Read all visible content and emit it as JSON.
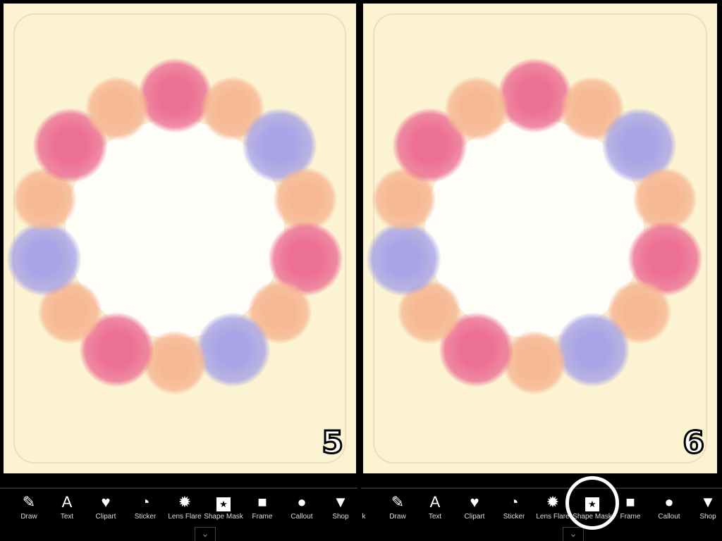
{
  "panels": [
    {
      "step_number": "5",
      "highlighted_tool": null
    },
    {
      "step_number": "6",
      "highlighted_tool": "Shape Mask"
    }
  ],
  "toolbar": {
    "tools": [
      {
        "label": "Draw",
        "icon": "brush-icon"
      },
      {
        "label": "Text",
        "icon": "text-a-icon"
      },
      {
        "label": "Clipart",
        "icon": "heart-star-icon"
      },
      {
        "label": "Sticker",
        "icon": "sticker-icon"
      },
      {
        "label": "Lens Flare",
        "icon": "lens-flare-icon"
      },
      {
        "label": "Shape Mask",
        "icon": "star-square-icon"
      },
      {
        "label": "Frame",
        "icon": "frame-icon"
      },
      {
        "label": "Callout",
        "icon": "speech-bubble-icon"
      },
      {
        "label": "Shop",
        "icon": "shopping-bag-icon"
      }
    ],
    "partial_left_label": "k",
    "expand_icon": "chevron-down-icon"
  },
  "colors": {
    "background": "#000000",
    "canvas": "#fbf3d2",
    "rose": "#ec6f94",
    "peach": "#f6b792",
    "lilac": "#a9a4e6"
  }
}
